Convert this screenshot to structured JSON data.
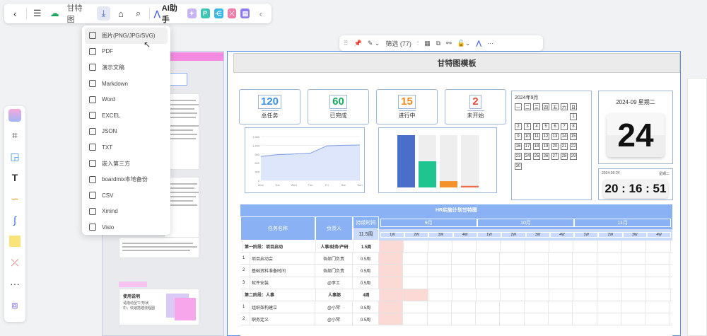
{
  "toolbar": {
    "title": "甘特图",
    "ai_label": "AI助手"
  },
  "export_menu": {
    "items": [
      {
        "label": "图片(PNG/JPG/SVG)",
        "icon": "image-icon"
      },
      {
        "label": "PDF",
        "icon": "pdf-icon"
      },
      {
        "label": "演示文稿",
        "icon": "presentation-icon"
      },
      {
        "label": "Markdown",
        "icon": "markdown-icon"
      },
      {
        "label": "Word",
        "icon": "word-icon"
      },
      {
        "label": "EXCEL",
        "icon": "excel-icon"
      },
      {
        "label": "JSON",
        "icon": "json-icon"
      },
      {
        "label": "TXT",
        "icon": "txt-icon"
      },
      {
        "label": "嵌入第三方",
        "icon": "embed-icon"
      },
      {
        "label": "boardmix本地备份",
        "icon": "backup-icon"
      },
      {
        "label": "CSV",
        "icon": "csv-icon"
      },
      {
        "label": "Xmind",
        "icon": "xmind-icon"
      },
      {
        "label": "Visio",
        "icon": "visio-icon"
      }
    ]
  },
  "float_toolbar": {
    "filter_label": "筛选 (77)"
  },
  "board": {
    "title": "甘特图模板"
  },
  "stats": [
    {
      "value": "120",
      "label": "总任务",
      "color": "#3b8fe0"
    },
    {
      "value": "60",
      "label": "已完成",
      "color": "#19a85c"
    },
    {
      "value": "15",
      "label": "进行中",
      "color": "#f08a1c"
    },
    {
      "value": "2",
      "label": "未开始",
      "color": "#e24b3b"
    }
  ],
  "calendar": {
    "header": "2024年9月",
    "weekdays": [
      "一",
      "二",
      "三",
      "四",
      "五",
      "六",
      "日"
    ],
    "weeks": [
      [
        "",
        "",
        "",
        "",
        "",
        "",
        "1"
      ],
      [
        "2",
        "3",
        "4",
        "5",
        "6",
        "7",
        "8"
      ],
      [
        "9",
        "10",
        "11",
        "12",
        "13",
        "14",
        "15"
      ],
      [
        "16",
        "17",
        "18",
        "19",
        "20",
        "21",
        "22"
      ],
      [
        "23",
        "24",
        "25",
        "26",
        "27",
        "28",
        "29"
      ],
      [
        "30",
        "",
        "",
        "",
        "",
        "",
        ""
      ]
    ]
  },
  "date_card": {
    "label": "2024-09 星期二",
    "day": "24"
  },
  "clock": {
    "date": "2024-09-24",
    "weekday": "星期二",
    "time": "20 : 16 : 51"
  },
  "line_chart": {
    "y_ticks": [
      "1,500",
      "1,200",
      "900",
      "600",
      "300",
      "0"
    ],
    "x_ticks": [
      "Mon",
      "Tue",
      "Wed",
      "Thu",
      "Fri",
      "Sat",
      "Sun"
    ]
  },
  "gantt": {
    "title": "HR实施计划甘特图",
    "col_task": "任务名称",
    "col_owner": "负责人",
    "col_duration": "持续时间",
    "col_duration_sub": "11.5周",
    "months": [
      "9月",
      "10月",
      "11月"
    ],
    "weeks": [
      "1W",
      "2W",
      "3W",
      "4W",
      "1W",
      "2W",
      "3W",
      "4W",
      "1W",
      "2W",
      "3W",
      "4W"
    ],
    "rows": [
      {
        "no": "",
        "task": "第一阶段：项目启动",
        "owner": "人事/财务/产研",
        "dur": "1.5周",
        "bold": true,
        "bar": [
          0,
          2
        ]
      },
      {
        "no": "1",
        "task": "项目启动会",
        "owner": "各部门负责",
        "dur": "0.5周",
        "bold": false,
        "bar": [
          0,
          1
        ]
      },
      {
        "no": "2",
        "task": "基础资料准备时间",
        "owner": "各部门负责",
        "dur": "0.5周",
        "bold": false,
        "bar": [
          0,
          1
        ]
      },
      {
        "no": "3",
        "task": "软件安装",
        "owner": "@李工",
        "dur": "0.5周",
        "bold": false,
        "bar": [
          0,
          1
        ]
      },
      {
        "no": "",
        "task": "第二阶段：人事",
        "owner": "人事部",
        "dur": "4周",
        "bold": true,
        "bar": [
          0,
          4
        ]
      },
      {
        "no": "1",
        "task": "组织架构建立",
        "owner": "@小琴",
        "dur": "0.5周",
        "bold": false,
        "bar": [
          0,
          1
        ]
      },
      {
        "no": "2",
        "task": "职务定义",
        "owner": "@小琴",
        "dur": "0.5周",
        "bold": false,
        "bar": [
          0,
          1
        ]
      }
    ]
  },
  "bar_chart": {
    "type": "bar",
    "values": [
      100,
      50,
      12,
      3
    ],
    "colors": [
      "#4a6fc8",
      "#1fc48f",
      "#f5902a",
      "#ee6b4d"
    ]
  },
  "sticky": {
    "title": "使用说明",
    "text": "请拖动至“F”形状中，快速搭建流程图"
  }
}
